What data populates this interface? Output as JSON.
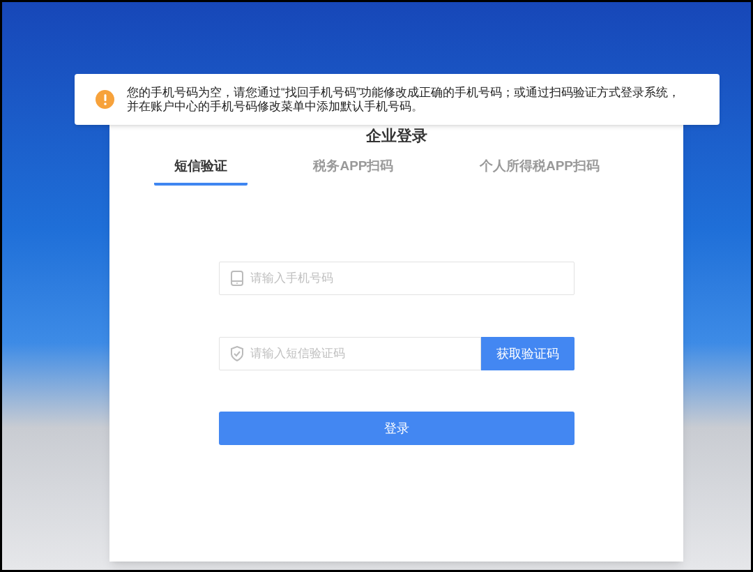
{
  "alert": {
    "kind": "warning",
    "message": "您的手机号码为空，请您通过“找回手机号码”功能修改成正确的手机号码；或通过扫码验证方式登录系统，并在账户中心的手机号码修改菜单中添加默认手机号码。"
  },
  "title": "企业登录",
  "tabs": [
    {
      "label": "短信验证",
      "selected": true
    },
    {
      "label": "税务APP扫码",
      "selected": false
    },
    {
      "label": "个人所得税APP扫码",
      "selected": false
    }
  ],
  "phone_field": {
    "placeholder": "请输入手机号码"
  },
  "code_field": {
    "placeholder": "请输入短信验证码"
  },
  "get_code_button": "获取验证码",
  "login_button": "登录"
}
